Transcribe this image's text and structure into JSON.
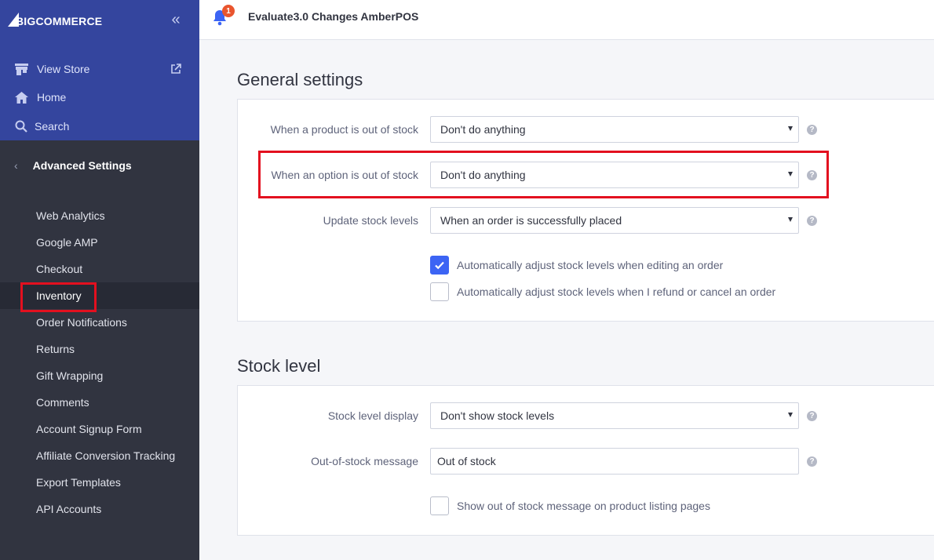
{
  "app": {
    "logo_text": "BIGCOMMERCE",
    "logo_big": "BIG",
    "logo_rest": "COMMERCE"
  },
  "header": {
    "store_name": "Evaluate3.0 Changes AmberPOS",
    "notification_count": "1"
  },
  "sidebar": {
    "top_items": [
      {
        "label": "View Store",
        "icon": "store-icon"
      },
      {
        "label": "Home",
        "icon": "home-icon"
      },
      {
        "label": "Search",
        "icon": "search-icon"
      }
    ],
    "section_title": "Advanced Settings",
    "items": [
      {
        "label": "Web Analytics"
      },
      {
        "label": "Google AMP"
      },
      {
        "label": "Checkout"
      },
      {
        "label": "Inventory",
        "active": true
      },
      {
        "label": "Order Notifications"
      },
      {
        "label": "Returns"
      },
      {
        "label": "Gift Wrapping"
      },
      {
        "label": "Comments"
      },
      {
        "label": "Account Signup Form"
      },
      {
        "label": "Affiliate Conversion Tracking"
      },
      {
        "label": "Export Templates"
      },
      {
        "label": "API Accounts"
      }
    ]
  },
  "general": {
    "title": "General settings",
    "product_oos": {
      "label": "When a product is out of stock",
      "value": "Don't do anything"
    },
    "option_oos": {
      "label": "When an option is out of stock",
      "value": "Don't do anything"
    },
    "update_stock": {
      "label": "Update stock levels",
      "value": "When an order is successfully placed"
    },
    "adjust_editing": {
      "label": "Automatically adjust stock levels when editing an order",
      "checked": true
    },
    "adjust_refund": {
      "label": "Automatically adjust stock levels when I refund or cancel an order",
      "checked": false
    }
  },
  "stock": {
    "title": "Stock level",
    "display": {
      "label": "Stock level display",
      "value": "Don't show stock levels"
    },
    "message": {
      "label": "Out-of-stock message",
      "value": "Out of stock"
    },
    "show_on_listing": {
      "label": "Show out of stock message on product listing pages",
      "checked": false
    }
  },
  "help_glyph": "?",
  "colors": {
    "sidebar_top": "#34459e",
    "sidebar": "#313440",
    "accent": "#3c64f4",
    "highlight": "#e3101f",
    "badge": "#e9552e"
  }
}
